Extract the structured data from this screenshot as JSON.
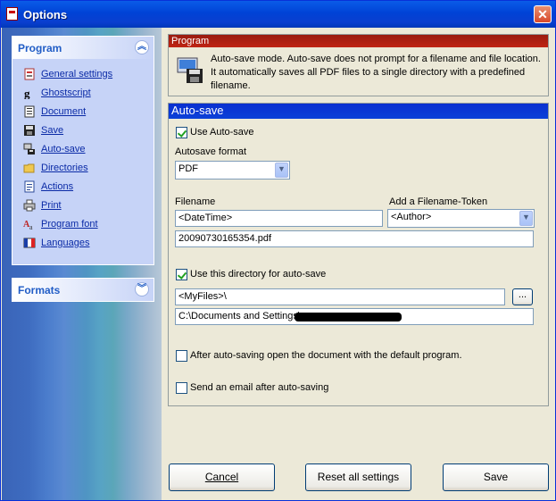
{
  "window": {
    "title": "Options",
    "close_glyph": "✕"
  },
  "sidebar": {
    "program_panel": {
      "title": "Program",
      "chevron": "︽",
      "items": [
        {
          "label": "General settings",
          "icon": "general-settings-icon"
        },
        {
          "label": "Ghostscript",
          "icon": "ghostscript-icon"
        },
        {
          "label": "Document",
          "icon": "document-icon"
        },
        {
          "label": "Save",
          "icon": "save-icon"
        },
        {
          "label": "Auto-save",
          "icon": "auto-save-icon"
        },
        {
          "label": "Directories",
          "icon": "directories-icon"
        },
        {
          "label": "Actions",
          "icon": "actions-icon"
        },
        {
          "label": "Print",
          "icon": "print-icon"
        },
        {
          "label": "Program font",
          "icon": "program-font-icon"
        },
        {
          "label": "Languages",
          "icon": "languages-icon"
        }
      ]
    },
    "formats_panel": {
      "title": "Formats",
      "chevron": "︾"
    }
  },
  "program_group": {
    "header": "Program",
    "description": "Auto-save mode. Auto-save does not prompt for a filename and file location. It automatically saves all PDF files to a single directory with a predefined filename."
  },
  "autosave_group": {
    "header": "Auto-save",
    "use_autosave": {
      "label": "Use Auto-save",
      "checked": true
    },
    "format_label": "Autosave format",
    "format_value": "PDF",
    "filename_label": "Filename",
    "filename_value": "<DateTime>",
    "token_label": "Add a Filename-Token",
    "token_value": "<Author>",
    "filename_preview": "20090730165354.pdf",
    "use_directory": {
      "label": "Use this directory for auto-save",
      "checked": true
    },
    "directory_value": "<MyFiles>\\",
    "browse_label": "...",
    "directory_preview": "C:\\Documents and Settings\\",
    "open_after": {
      "label": "After auto-saving open the document with the default program.",
      "checked": false
    },
    "send_email": {
      "label": "Send an email after auto-saving",
      "checked": false
    }
  },
  "buttons": {
    "cancel": "Cancel",
    "reset": "Reset all settings",
    "save": "Save"
  }
}
